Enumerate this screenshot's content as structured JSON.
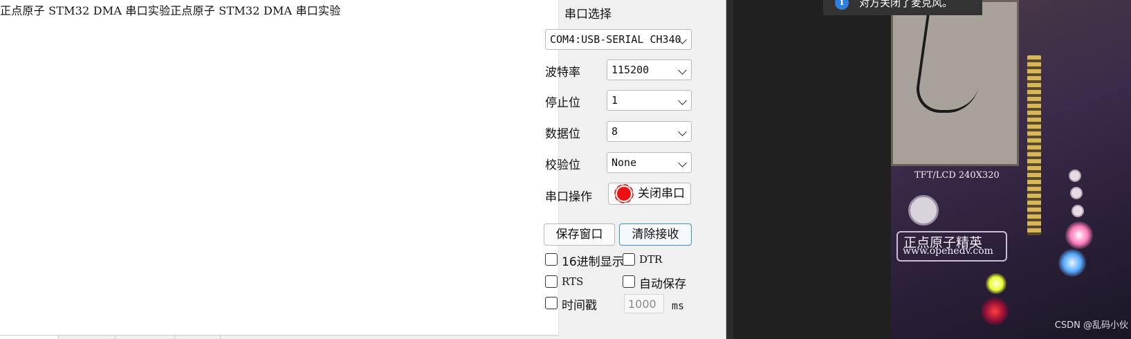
{
  "receive": {
    "text": "正点原子 STM32 DMA 串口实验正点原子 STM32 DMA 串口实验"
  },
  "serial": {
    "port_label": "串口选择",
    "port_value": "COM4:USB-SERIAL CH340",
    "baud_label": "波特率",
    "baud_value": "115200",
    "stopbits_label": "停止位",
    "stopbits_value": "1",
    "databits_label": "数据位",
    "databits_value": "8",
    "parity_label": "校验位",
    "parity_value": "None",
    "operation_label": "串口操作",
    "close_port_label": "关闭串口",
    "led_color": "#ee1111"
  },
  "actions": {
    "save_window": "保存窗口",
    "clear_receive": "清除接收"
  },
  "options": {
    "hex_display": "16进制显示",
    "dtr": "DTR",
    "rts": "RTS",
    "auto_save": "自动保存",
    "timestamp": "时间戳",
    "timestamp_value": "1000",
    "timestamp_unit": "ms"
  },
  "notification": {
    "icon": "info-icon",
    "text": "对方关闭了麦克风。",
    "color": "#2d7fe0"
  },
  "video": {
    "pcb_model": "TFT/LCD 240X320",
    "brand": "正点原子精英",
    "url": "www.openedv.com",
    "watermark": "CSDN @乱码小伙"
  }
}
